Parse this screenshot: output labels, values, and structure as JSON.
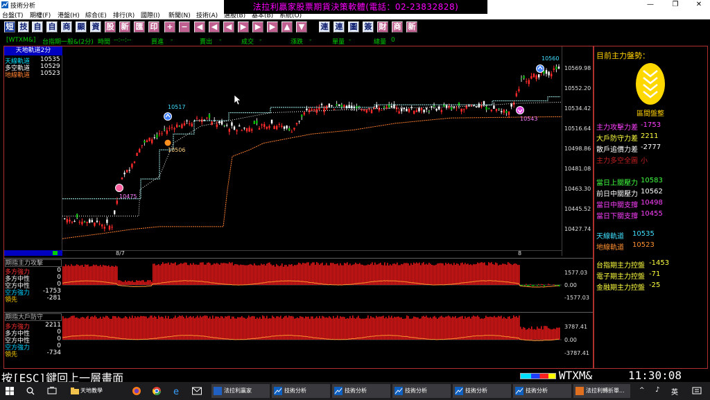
{
  "window": {
    "title": "技術分析",
    "controls": [
      "—",
      "❐",
      "✕"
    ]
  },
  "banner": "法拉利贏家股票期貨決策軟體(電話：02-23832828)",
  "menu": [
    "台盤(T)",
    "期權(F)",
    "港盤(H)",
    "綜合(E)",
    "排行(R)",
    "國際(I)",
    "新聞(N)",
    "技術(A)",
    "選股(B)",
    "基本(B)",
    "系統(O)"
  ],
  "toolbar": {
    "buttons": [
      "短",
      "技",
      "自",
      "商",
      "顯",
      "資",
      "股",
      "新",
      "匯",
      "印",
      "+",
      "−",
      "◀",
      "◀",
      "◀",
      "▶",
      "▶",
      "▶",
      "▲",
      "▼",
      "連",
      "連",
      "圖",
      "簽",
      "財",
      "商",
      "新"
    ]
  },
  "infobar": {
    "code": "[WTXM&]",
    "name": "台指期一般&(2分)",
    "time_label": "時間",
    "time_value": "--:--:--",
    "buy_label": "買進",
    "buy_value": "-",
    "sell_label": "賣出",
    "sell_value": "-",
    "deal_label": "成交",
    "deal_value": "-",
    "change_label": "漲跌",
    "change_value": "-",
    "volume_label": "單量",
    "volume_value": "-",
    "total_label": "總量",
    "total_value": "0"
  },
  "legend": {
    "title": "天地軌道2分",
    "rows": [
      {
        "label": "天線軌道",
        "value": "10535",
        "color": "#00e0ff"
      },
      {
        "label": "多空軌道",
        "value": "10529",
        "color": "#ffffff"
      },
      {
        "label": "地線軌道",
        "value": "10523",
        "color": "#ff8030"
      }
    ]
  },
  "markers": {
    "m10560": "10560",
    "m10517": "10517",
    "m10506": "10506",
    "m10475": "10475",
    "m10543": "10543"
  },
  "date_labels": [
    "8/7",
    "8"
  ],
  "panel1": {
    "title": "期指主力攻擊",
    "rows": [
      {
        "label": "多方強力",
        "value": "0",
        "color": "#ff3030"
      },
      {
        "label": "多方中性",
        "value": "0",
        "color": "#ffffff"
      },
      {
        "label": "空方中性",
        "value": "0",
        "color": "#ffffff"
      },
      {
        "label": "空方強力",
        "value": "-1753",
        "color": "#00d0ff"
      },
      {
        "label": "領先",
        "value": "-281",
        "color": "#ffd000"
      }
    ],
    "axis": [
      "1577.03",
      "0.00",
      "-1577.03"
    ]
  },
  "panel2": {
    "title": "期指大戶防守",
    "rows": [
      {
        "label": "多方強力",
        "value": "2211",
        "color": "#ff3030"
      },
      {
        "label": "多方中性",
        "value": "0",
        "color": "#ffffff"
      },
      {
        "label": "空方中性",
        "value": "0",
        "color": "#ffffff"
      },
      {
        "label": "空方強力",
        "value": "0",
        "color": "#00d0ff"
      },
      {
        "label": "領先",
        "value": "-734",
        "color": "#ffd000"
      }
    ],
    "axis": [
      "3787.41",
      "0.00",
      "-3787.41"
    ]
  },
  "side": {
    "header": "目前主力盤勢：",
    "state": "區間盤整",
    "groups": [
      [
        {
          "label": "主力攻擊力差",
          "value": "-1753",
          "color": "#ff40ff"
        },
        {
          "label": "大戶防守力差",
          "value": "2211",
          "color": "#ffff40"
        },
        {
          "label": "散戶追價力差",
          "value": "-2777",
          "color": "#ffffff"
        },
        {
          "label": "主力多空全圖",
          "value": "小",
          "color": "#c02020"
        }
      ],
      [
        {
          "label": "當日上關壓力",
          "value": "10583",
          "color": "#40ff40"
        },
        {
          "label": "前日中關壓力",
          "value": "10562",
          "color": "#ffffff"
        },
        {
          "label": "當日中關支撐",
          "value": "10498",
          "color": "#ff40ff"
        },
        {
          "label": "當日下關支撐",
          "value": "10455",
          "color": "#ff40ff"
        }
      ],
      [
        {
          "label": "天線軌道",
          "value": "10535",
          "color": "#40e0ff"
        },
        {
          "label": "地線軌道",
          "value": "10523",
          "color": "#ff9030"
        }
      ],
      [
        {
          "label": "台指期主力控盤",
          "value": "-1453",
          "color": "#ffff40"
        },
        {
          "label": "電子期主力控盤",
          "value": "-71",
          "color": "#ffff40"
        },
        {
          "label": "金融期主力控盤",
          "value": "-25",
          "color": "#ffff40"
        }
      ]
    ]
  },
  "status": {
    "hint": "按[ESC]鍵回上一層畫面",
    "symbol": "WTXM&",
    "clock": "11:30:08"
  },
  "taskbar": {
    "items": [
      "天地教學",
      "法拉利贏家",
      "技術分析",
      "技術分析",
      "技術分析",
      "技術分析",
      "技術分析",
      "法拉利轉折單..."
    ],
    "tray_lang": "英",
    "tray_icons": [
      "^",
      "♪",
      "英"
    ]
  },
  "chart_data": [
    {
      "type": "candlestick",
      "title": "天地軌道2分",
      "y_ticks": [
        "10569.98",
        "10552.20",
        "10534.42",
        "10516.64",
        "10498.86",
        "10481.08",
        "10463.30",
        "10445.52",
        "10427.74"
      ],
      "ylim": [
        10420,
        10578
      ],
      "x_labels": [
        "8/7",
        "8"
      ],
      "series": [
        {
          "name": "天線軌道",
          "last": 10535
        },
        {
          "name": "多空軌道",
          "last": 10529
        },
        {
          "name": "地線軌道",
          "last": 10523
        }
      ],
      "annotations": [
        10560,
        10517,
        10506,
        10475,
        10543
      ]
    },
    {
      "type": "bar",
      "title": "期指主力攻擊",
      "y_ticks": [
        "1577.03",
        "0.00",
        "-1577.03"
      ],
      "ylim": [
        -1577.03,
        1577.03
      ]
    },
    {
      "type": "bar",
      "title": "期指大戶防守",
      "y_ticks": [
        "3787.41",
        "0.00",
        "-3787.41"
      ],
      "ylim": [
        -3787.41,
        3787.41
      ]
    }
  ]
}
